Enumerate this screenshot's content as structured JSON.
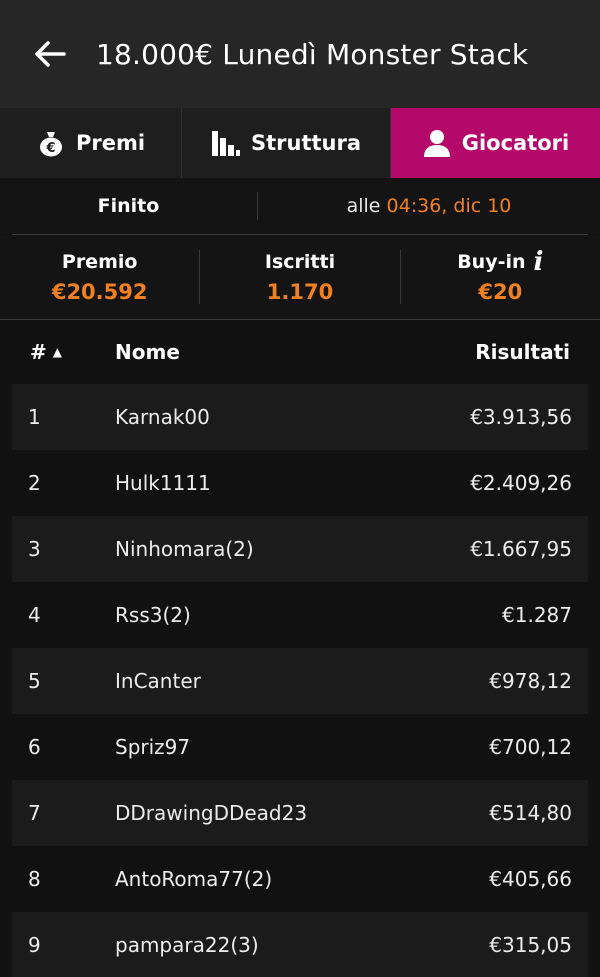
{
  "header": {
    "title": "18.000€ Lunedì Monster Stack"
  },
  "tabs": [
    {
      "label": "Premi",
      "icon": "money-bag-icon"
    },
    {
      "label": "Struttura",
      "icon": "bar-chart-icon"
    },
    {
      "label": "Giocatori",
      "icon": "user-icon",
      "active": true
    }
  ],
  "status": {
    "state": "Finito",
    "at_prefix": "alle",
    "datetime": "04:36, dic 10"
  },
  "stats": {
    "prize_label": "Premio",
    "prize_value": "€20.592",
    "entries_label": "Iscritti",
    "entries_value": "1.170",
    "buyin_label": "Buy-in",
    "buyin_value": "€20"
  },
  "table": {
    "col_num": "#",
    "col_name": "Nome",
    "col_result": "Risultati",
    "rows": [
      {
        "pos": "1",
        "name": "Karnak00",
        "result": "€3.913,56"
      },
      {
        "pos": "2",
        "name": "Hulk1111",
        "result": "€2.409,26"
      },
      {
        "pos": "3",
        "name": "Ninhomara(2)",
        "result": "€1.667,95"
      },
      {
        "pos": "4",
        "name": "Rss3(2)",
        "result": "€1.287"
      },
      {
        "pos": "5",
        "name": "InCanter",
        "result": "€978,12"
      },
      {
        "pos": "6",
        "name": "Spriz97",
        "result": "€700,12"
      },
      {
        "pos": "7",
        "name": "DDrawingDDead23",
        "result": "€514,80"
      },
      {
        "pos": "8",
        "name": "AntoRoma77(2)",
        "result": "€405,66"
      },
      {
        "pos": "9",
        "name": "pampara22(3)",
        "result": "€315,05"
      }
    ]
  },
  "colors": {
    "accent": "#b5086b",
    "highlight": "#f08020",
    "background": "#111111"
  }
}
